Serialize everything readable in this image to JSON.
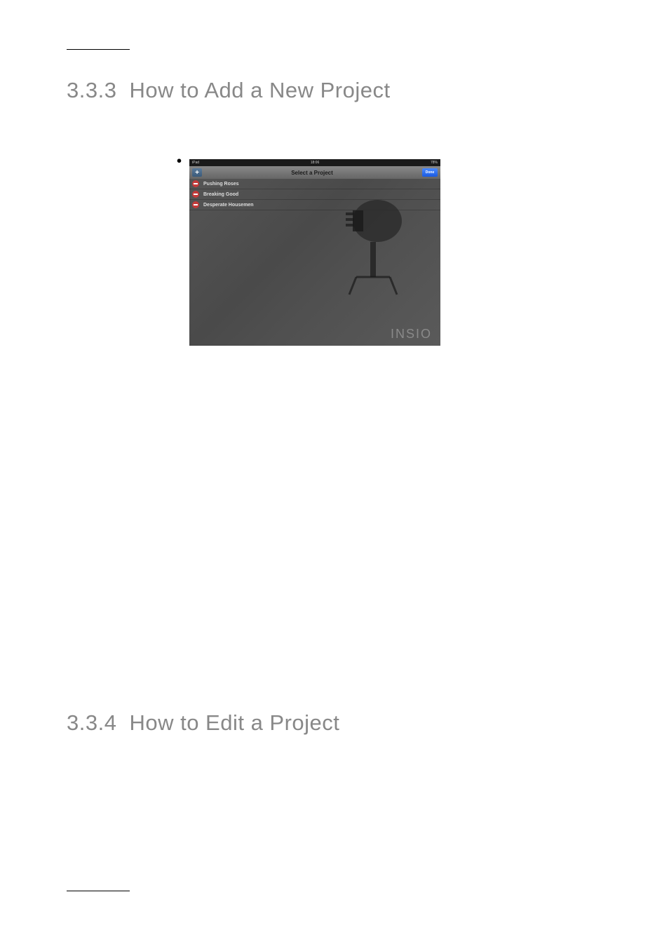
{
  "sections": [
    {
      "number": "3.3.3",
      "title": "How to Add a New Project"
    },
    {
      "number": "3.3.4",
      "title": "How to Edit a Project"
    }
  ],
  "ipad": {
    "statusbar": {
      "left": "iPad",
      "center": "18:06",
      "right": "78%"
    },
    "navbar": {
      "add": "+",
      "title": "Select a Project",
      "done": "Done"
    },
    "projects": [
      "Pushing Roses",
      "Breaking Good",
      "Desperate Housemen"
    ],
    "logo": "INSIO"
  }
}
